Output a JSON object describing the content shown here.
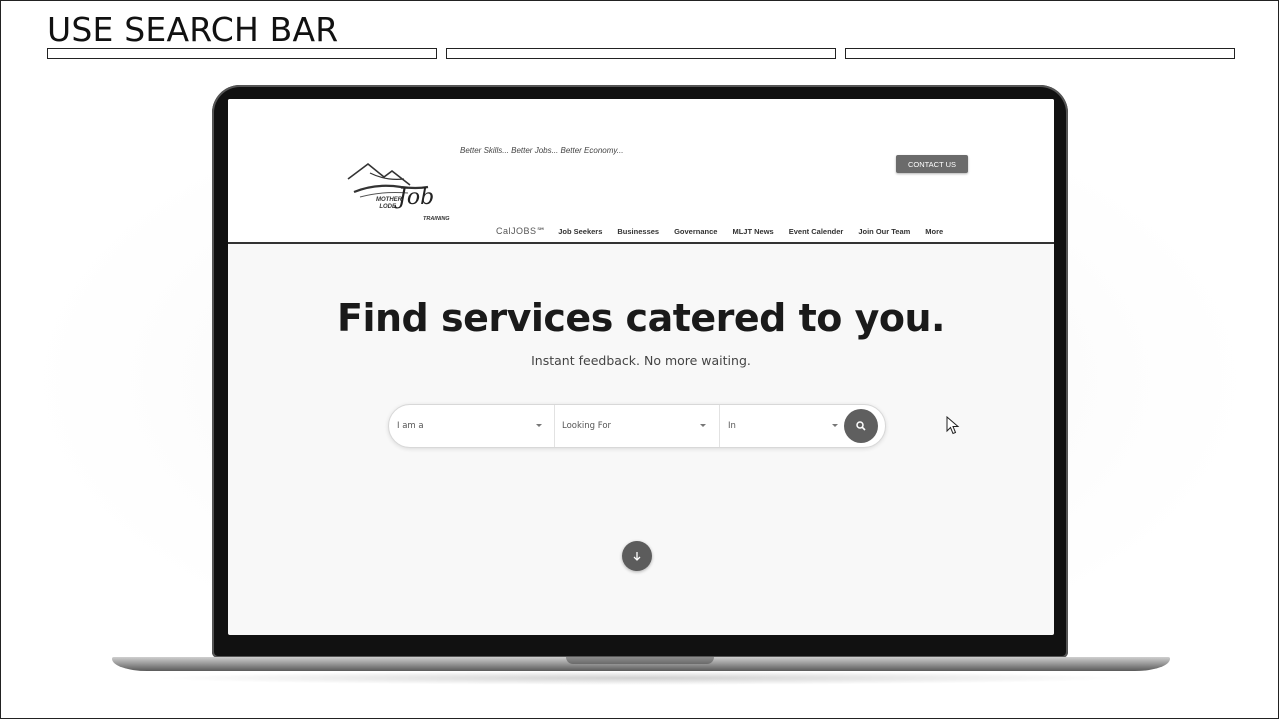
{
  "slide": {
    "title": "USE SEARCH BAR"
  },
  "site": {
    "tagline": "Better Skills... Better Jobs... Better Economy...",
    "contact_button": "CONTACT US",
    "logo": {
      "mother_lode": "MOTHER\nLODE",
      "job": "Job",
      "training": "TRAINING"
    },
    "nav": {
      "caljobs": "CalJOBS℠",
      "items": [
        "Job Seekers",
        "Businesses",
        "Governance",
        "MLJT News",
        "Event Calender",
        "Join Our Team",
        "More"
      ]
    }
  },
  "hero": {
    "title": "Find services catered to you.",
    "subtitle": "Instant feedback. No more waiting."
  },
  "search": {
    "field1": "I am a",
    "field2": "Looking For",
    "field3": "In"
  },
  "icons": {
    "search": "search-icon",
    "scroll_down": "arrow-down-icon",
    "cursor": "mouse-pointer-icon"
  }
}
